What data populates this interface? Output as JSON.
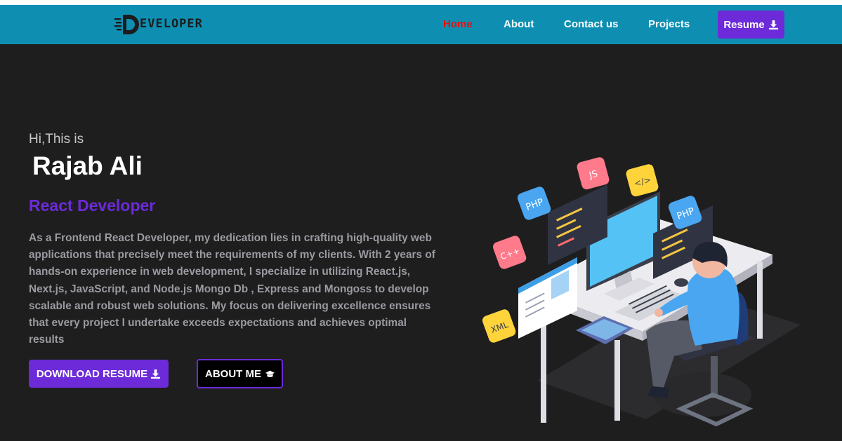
{
  "logo": {
    "letter": "D",
    "text": "EVELOPER"
  },
  "nav": {
    "items": [
      {
        "label": "Home",
        "active": true
      },
      {
        "label": "About",
        "active": false
      },
      {
        "label": "Contact us",
        "active": false
      },
      {
        "label": "Projects",
        "active": false
      }
    ],
    "resume_label": "Resume",
    "resume_icon": "download-icon"
  },
  "hero": {
    "greeting": "Hi,This is",
    "name": "Rajab Ali",
    "role": "React Developer",
    "description": "As a Frontend React Developer, my dedication lies in crafting high-quality web applications that precisely meet the requirements of my clients. With 2 years of hands-on experience in web development, I specialize in utilizing React.js, Next.js, JavaScript, and Node.js Mongo Db , Express and Mongoss to develop scalable and robust web solutions. My focus on delivering excellence ensures that every project I undertake exceeds expectations and achieves optimal results",
    "download_label": "DOWNLOAD RESUME",
    "about_label": "ABOUT ME"
  },
  "illustration": {
    "badges": [
      "PHP",
      "JS",
      "</>",
      "PHP",
      "C++",
      "XML"
    ]
  },
  "colors": {
    "navbar": "#0e8fb2",
    "background": "#1e1e1f",
    "accent": "#6c2ad9",
    "active_link": "#e81010"
  }
}
